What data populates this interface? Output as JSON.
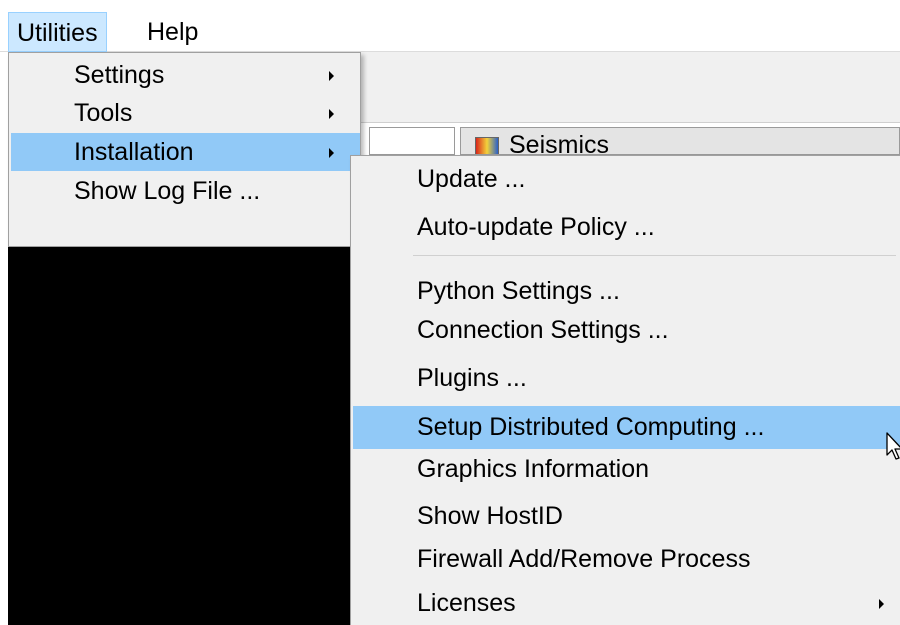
{
  "menubar": {
    "items": [
      {
        "label": "Utilities",
        "active": true
      },
      {
        "label": "Help",
        "active": false
      }
    ]
  },
  "background": {
    "tab_label": "Seismics"
  },
  "utilities_menu": {
    "items": [
      {
        "label": "Settings",
        "submenu": true
      },
      {
        "label": "Tools",
        "submenu": true
      },
      {
        "label": "Installation",
        "submenu": true,
        "highlighted": true
      },
      {
        "label": "Show Log File ...",
        "submenu": false
      }
    ]
  },
  "installation_menu": {
    "groups": [
      [
        {
          "label": "Update ..."
        },
        {
          "label": "Auto-update Policy ..."
        }
      ],
      [
        {
          "label": "Python Settings ..."
        },
        {
          "label": "Connection Settings ..."
        },
        {
          "label": "Plugins ..."
        },
        {
          "label": "Setup Distributed Computing ...",
          "highlighted": true
        },
        {
          "label": "Graphics Information"
        },
        {
          "label": "Show HostID"
        },
        {
          "label": "Firewall Add/Remove Process"
        },
        {
          "label": "Licenses",
          "submenu": true
        }
      ]
    ]
  },
  "icons": {
    "submenu_arrow": "chevron-right-icon",
    "cursor": "mouse-pointer-icon"
  },
  "colors": {
    "highlight": "#91c9f7",
    "menubar_active": "#cce8ff",
    "menu_bg": "#f0f0f0"
  }
}
